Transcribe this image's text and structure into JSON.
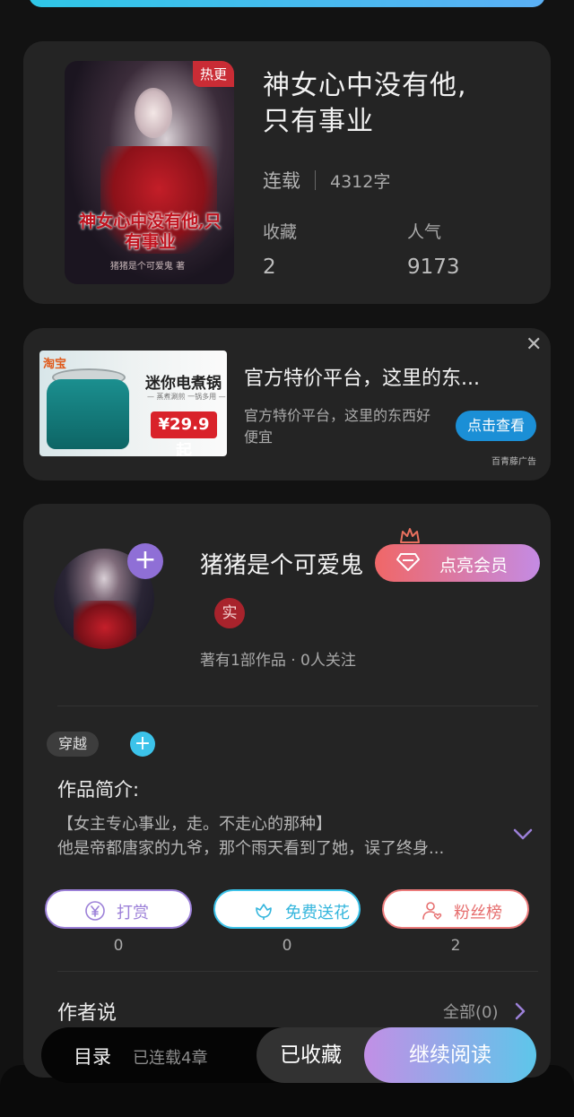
{
  "book": {
    "badge": "热更",
    "cover_title": "神女心中没有他,只有事业",
    "cover_author": "猪猪是个可爱鬼 著",
    "title_line1": "神女心中没有他,",
    "title_line2": "只有事业",
    "status": "连载",
    "word_count": "4312字",
    "favorites_label": "收藏",
    "favorites_value": "2",
    "popularity_label": "人气",
    "popularity_value": "9173"
  },
  "ad": {
    "image_brand": "淘宝",
    "image_product": "迷你电煮锅",
    "image_tagline": "— 蒸煮涮煎 一锅多用 —",
    "image_price": "¥29.9起",
    "title": "官方特价平台，这里的东...",
    "description": "官方特价平台，这里的东西好便宜",
    "button": "点击查看",
    "close": "✕",
    "source": "百青藤广告"
  },
  "author": {
    "follow_plus": "+",
    "name": "猪猪是个可爱鬼",
    "vip_button": "点亮会员",
    "verified_badge": "实",
    "works_info": "著有1部作品 · 0人关注"
  },
  "tags": {
    "items": [
      "穿越"
    ],
    "add": "+"
  },
  "intro": {
    "title": "作品简介:",
    "line1": "【女主专心事业，走。不走心的那种】",
    "line2": "他是帝都唐家的九爷，那个雨天看到了她，误了终身..."
  },
  "actions": {
    "reward": {
      "label": "打赏",
      "count": "0",
      "icon": "yen-coin-icon"
    },
    "flower": {
      "label": "免费送花",
      "count": "0",
      "icon": "flower-icon"
    },
    "fans": {
      "label": "粉丝榜",
      "count": "2",
      "icon": "user-heart-icon"
    }
  },
  "author_says": {
    "title": "作者说",
    "all": "全部(0)"
  },
  "bottom": {
    "toc": "目录",
    "progress": "已连载4章",
    "favorite": "已收藏",
    "continue": "继续阅读"
  },
  "colors": {
    "accent_purple": "#9c80d8",
    "accent_cyan": "#3cc3ea",
    "accent_red": "#ec7b7b",
    "background": "#121212",
    "card": "#242424"
  }
}
